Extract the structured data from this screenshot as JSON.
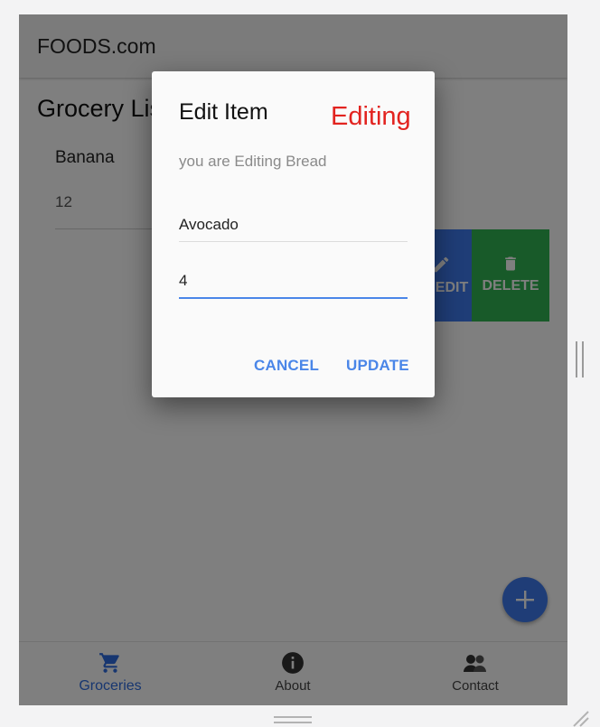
{
  "app": {
    "title": "FOODS.com"
  },
  "page": {
    "title": "Grocery List"
  },
  "list": {
    "items": [
      {
        "name": "Banana",
        "quantity": "12"
      }
    ],
    "swipe_actions": {
      "edit_label": "EDIT",
      "delete_label": "DELETE"
    }
  },
  "fab": {
    "icon": "plus-icon"
  },
  "bottom_nav": {
    "items": [
      {
        "label": "Groceries",
        "icon": "cart-icon",
        "active": true
      },
      {
        "label": "About",
        "icon": "info-icon",
        "active": false
      },
      {
        "label": "Contact",
        "icon": "contact-icon",
        "active": false
      }
    ]
  },
  "dialog": {
    "title": "Edit Item",
    "message": "you are Editing Bread",
    "name_value": "Avocado",
    "quantity_value": "4",
    "cancel_label": "CANCEL",
    "update_label": "UPDATE"
  },
  "annotation": {
    "text": "Editing"
  },
  "colors": {
    "accent": "#3e7bef",
    "delete": "#30b553",
    "annotation": "#e2231f",
    "dialog_button": "#4a86e8"
  }
}
